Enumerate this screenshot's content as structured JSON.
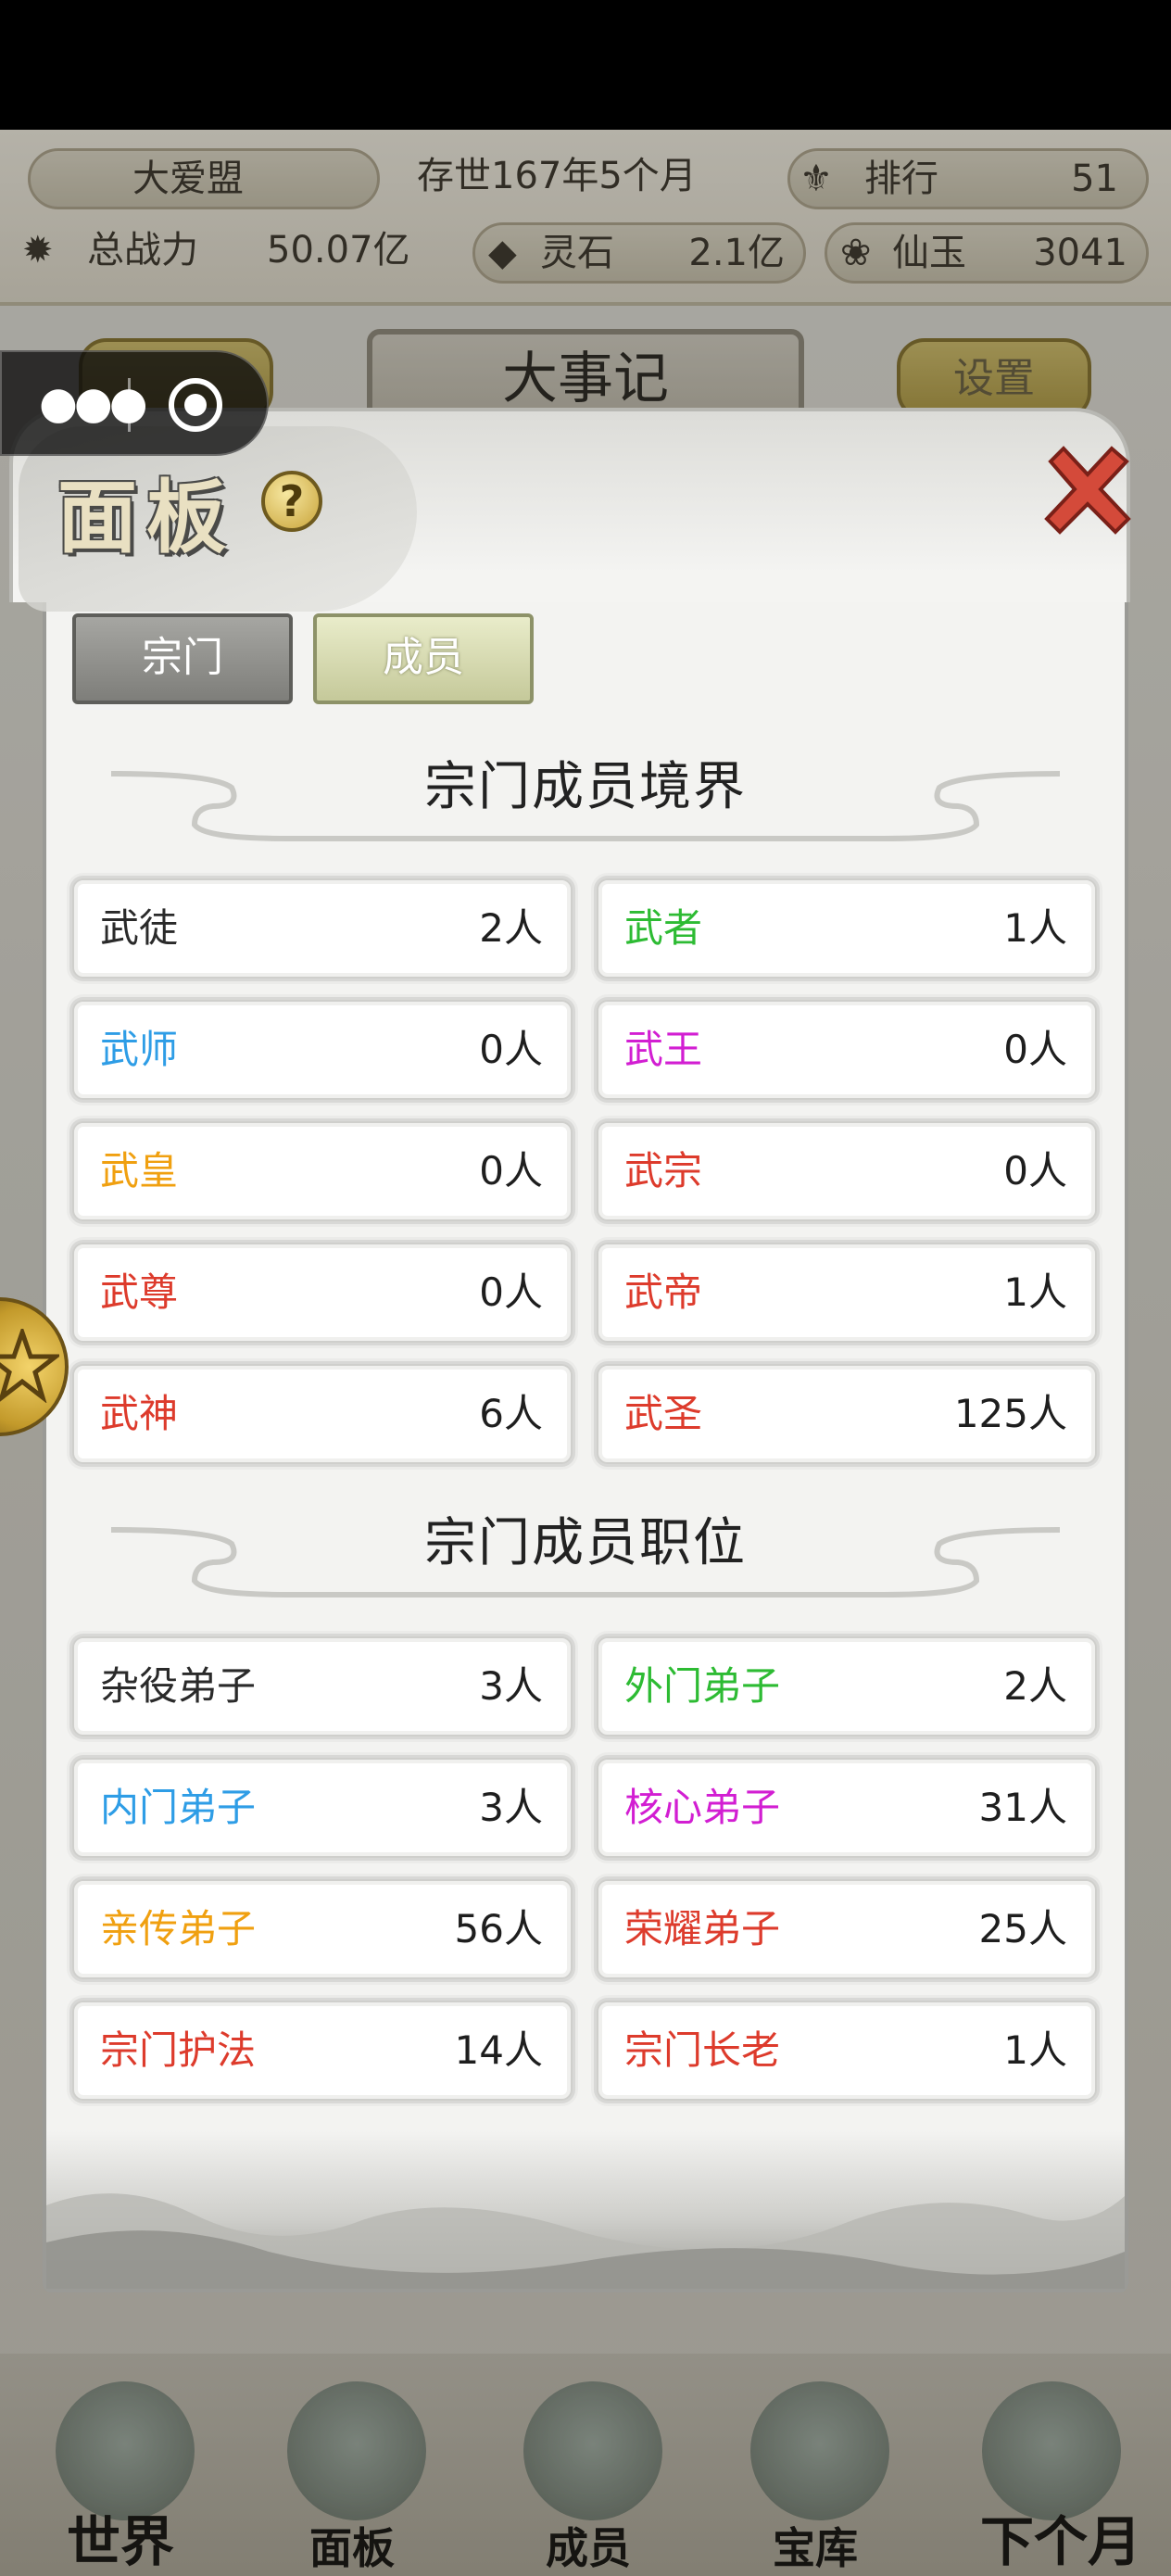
{
  "header": {
    "alliance": "大爱盟",
    "time": "存世167年5个月",
    "rank_label": "排行",
    "rank_value": "51",
    "power_label": "总战力",
    "power_value": "50.07亿",
    "spirit_label": "灵石",
    "spirit_value": "2.1亿",
    "jade_label": "仙玉",
    "jade_value": "3041"
  },
  "top": {
    "title": "大事记",
    "right_button": "设置"
  },
  "panel": {
    "title": "面板",
    "help": "?",
    "tabs": [
      {
        "label": "宗门",
        "active": false
      },
      {
        "label": "成员",
        "active": true
      }
    ],
    "realm_section_title": "宗门成员境界",
    "realms": [
      {
        "name": "武徒",
        "count": "2人",
        "color": "#2a2a2a"
      },
      {
        "name": "武者",
        "count": "1人",
        "color": "#2dbb33"
      },
      {
        "name": "武师",
        "count": "0人",
        "color": "#2e9de6"
      },
      {
        "name": "武王",
        "count": "0人",
        "color": "#d21ed2"
      },
      {
        "name": "武皇",
        "count": "0人",
        "color": "#f0a010"
      },
      {
        "name": "武宗",
        "count": "0人",
        "color": "#dd3b2c"
      },
      {
        "name": "武尊",
        "count": "0人",
        "color": "#dd3b2c"
      },
      {
        "name": "武帝",
        "count": "1人",
        "color": "#dd3b2c"
      },
      {
        "name": "武神",
        "count": "6人",
        "color": "#dd3b2c"
      },
      {
        "name": "武圣",
        "count": "125人",
        "color": "#dd3b2c"
      }
    ],
    "position_section_title": "宗门成员职位",
    "positions": [
      {
        "name": "杂役弟子",
        "count": "3人",
        "color": "#2a2a2a"
      },
      {
        "name": "外门弟子",
        "count": "2人",
        "color": "#2dbb33"
      },
      {
        "name": "内门弟子",
        "count": "3人",
        "color": "#2e9de6"
      },
      {
        "name": "核心弟子",
        "count": "31人",
        "color": "#d21ed2"
      },
      {
        "name": "亲传弟子",
        "count": "56人",
        "color": "#f0a010"
      },
      {
        "name": "荣耀弟子",
        "count": "25人",
        "color": "#dd3b2c"
      },
      {
        "name": "宗门护法",
        "count": "14人",
        "color": "#dd3b2c"
      },
      {
        "name": "宗门长老",
        "count": "1人",
        "color": "#dd3b2c"
      }
    ]
  },
  "bottom_nav": [
    {
      "label": "世界",
      "icon": "world-icon"
    },
    {
      "label": "面板",
      "icon": "panel-icon"
    },
    {
      "label": "成员",
      "icon": "member-icon"
    },
    {
      "label": "宝库",
      "icon": "treasury-icon"
    },
    {
      "label": "下个月",
      "icon": "next-month-icon"
    }
  ]
}
